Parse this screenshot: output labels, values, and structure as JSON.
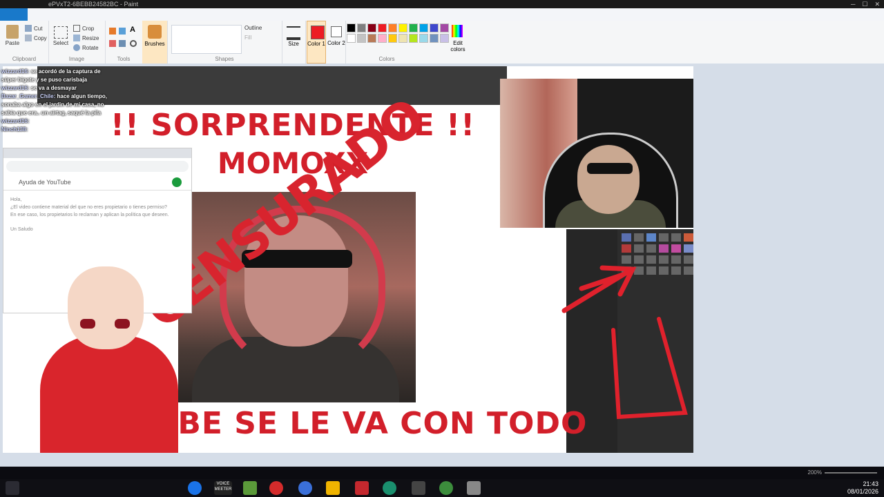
{
  "window": {
    "title": "ePVxT2-6BEBB24582BC - Paint",
    "controls": [
      "─",
      "☐",
      "✕"
    ]
  },
  "ribbon": {
    "file_tab": "",
    "tabs": [],
    "groups": {
      "clipboard": {
        "label": "Clipboard",
        "paste": "Paste",
        "cut": "Cut",
        "copy": "Copy"
      },
      "image": {
        "label": "Image",
        "select": "Select",
        "crop": "Crop",
        "resize": "Resize",
        "rotate": "Rotate"
      },
      "tools": {
        "label": "Tools"
      },
      "brushes": {
        "label": "Brushes"
      },
      "shapes": {
        "label": "Shapes",
        "outline": "Outline",
        "fill": "Fill"
      },
      "size": {
        "label": "Size"
      },
      "color1": {
        "label": "Color 1"
      },
      "color2": {
        "label": "Color 2"
      },
      "colors": {
        "label": "Colors",
        "edit": "Edit colors"
      }
    },
    "palette": [
      "#000000",
      "#7f7f7f",
      "#880015",
      "#ed1c24",
      "#ff7f27",
      "#fff200",
      "#22b14c",
      "#00a2e8",
      "#3f48cc",
      "#a349a4",
      "#ffffff",
      "#c3c3c3",
      "#b97a57",
      "#ffaec9",
      "#ffc90e",
      "#efe4b0",
      "#b5e61d",
      "#99d9ea",
      "#7092be",
      "#c8bfe7"
    ]
  },
  "chat": [
    {
      "user": "wizzard16:",
      "msg": "se acordó de la captura de súper bigote y se puso carisbaja"
    },
    {
      "user": "wizzard16:",
      "msg": "se va a desmayar"
    },
    {
      "user": "Bazar_Gamer_Chile:",
      "msg": "hace algun tiempo, sonaba algo en el jardin de mi casa, no sabia que era.. un airtag, saqué la pila"
    },
    {
      "user": "wizzard16:",
      "msg": ""
    },
    {
      "user": "Ninch138:",
      "msg": ""
    }
  ],
  "image": {
    "headline": "!! SORPRENDENTE !!",
    "name": "MOMOXX",
    "stamp": "CENSURADO",
    "bottom": "IBE SE LE VA CON TODO",
    "browser": {
      "search_label": "Ayuda de YouTube",
      "body_lines": [
        "Hola,",
        "¿El video contiene material del que no eres propietario o tienes permiso?",
        "En ese caso, los propietarios lo reclaman y aplican la política que deseen.",
        "Un Saludo"
      ]
    }
  },
  "statusbar": {
    "zoom": "200%"
  },
  "taskbar": {
    "time": "21:43",
    "date": "08/01/2026",
    "meeter_label": "VOICE\nMEETER"
  },
  "colors": {
    "accent_red": "#d21f2a",
    "ribbon_bg": "#f5f6f7",
    "taskbar_bg": "#0f0f14"
  }
}
